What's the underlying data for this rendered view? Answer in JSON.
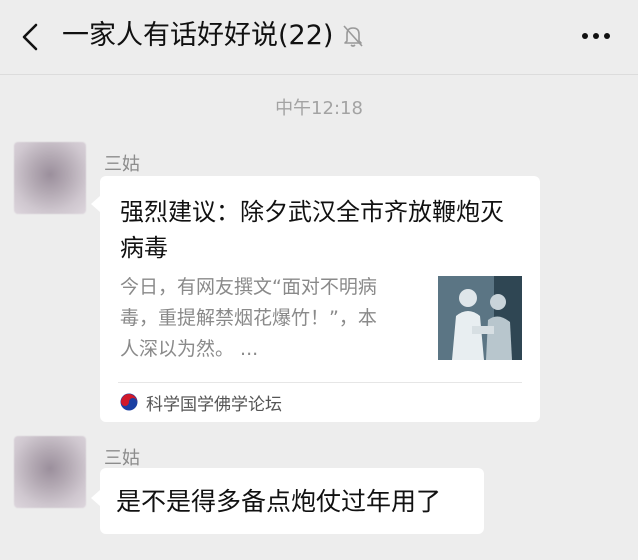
{
  "header": {
    "title": "一家人有话好好说(22)",
    "back_icon": "chevron-left-icon",
    "mute_icon": "bell-muted-icon",
    "more_icon": "more-dots-icon"
  },
  "messages": {
    "timestamp": "中午12:18",
    "items": [
      {
        "sender": "三姑",
        "type": "link-card",
        "title": "强烈建议：除夕武汉全市齐放鞭炮灭病毒",
        "description": "今日，有网友撰文“面对不明病毒，重提解禁烟花爆竹！”，本人深以为然。 ...",
        "source": "科学国学佛学论坛"
      },
      {
        "sender": "三姑",
        "type": "text",
        "text": "是不是得多备点炮仗过年用了"
      }
    ]
  },
  "colors": {
    "background": "#ededed",
    "bubble": "#ffffff",
    "secondary_text": "#8c8c8c"
  }
}
